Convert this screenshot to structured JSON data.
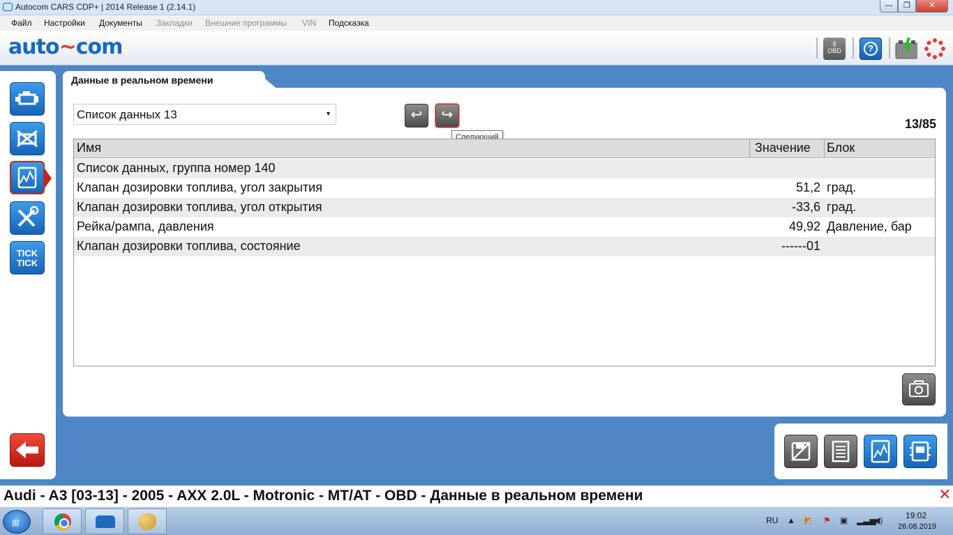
{
  "window": {
    "title": "Autocom CARS CDP+ | 2014 Release 1 (2.14.1)",
    "min_glyph": "—",
    "max_glyph": "❐",
    "close_glyph": "✕"
  },
  "menu": {
    "items": [
      {
        "label": "Файл"
      },
      {
        "label": "Настройки"
      },
      {
        "label": "Документы"
      },
      {
        "label": "Закладки"
      },
      {
        "label": "Внешние программы"
      },
      {
        "label": "VIN"
      },
      {
        "label": "Подсказка"
      }
    ]
  },
  "header": {
    "logo_left": "auto",
    "logo_wave": "~",
    "logo_right": "com",
    "obd_label": "OBD",
    "obd_symbol": "§",
    "help_glyph": "?"
  },
  "tab": {
    "title": "Данные в реальном времени"
  },
  "controls": {
    "list_value": "Список данных 13",
    "list_caret": "▼",
    "prev_glyph": "↩",
    "next_glyph": "↪",
    "tooltip": "Следующий",
    "page_counter": "13/85"
  },
  "grid": {
    "headers": {
      "name": "Имя",
      "value": "Значение",
      "unit": "Блок"
    },
    "rows": [
      {
        "name": "Список данных, группа номер 140",
        "value": "",
        "unit": ""
      },
      {
        "name": "Клапан дозировки топлива, угол закрытия",
        "value": "51,2",
        "unit": "град."
      },
      {
        "name": "Клапан дозировки топлива, угол открытия",
        "value": "-33,6",
        "unit": "град."
      },
      {
        "name": "Рейка/рампа, давления",
        "value": "49,92",
        "unit": "Давление, бар"
      },
      {
        "name": "Клапан дозировки топлива, состояние",
        "value": "------01",
        "unit": ""
      }
    ]
  },
  "sidebar": {
    "tick_label": "TICK\nTICK"
  },
  "status": {
    "text": "Audi - A3 [03-13] - 2005 - AXX 2.0L - Motronic - MT/AT - OBD - Данные в реальном времени"
  },
  "taskbar": {
    "language": "RU",
    "time": "19:02",
    "date": "26.08.2019"
  },
  "icons": {
    "engine": "engine-icon",
    "dtc": "dtc-clear-icon",
    "live_data": "live-data-icon",
    "tools": "tools-icon",
    "tick": "tick-tick-icon",
    "back": "back-arrow-icon",
    "camera": "camera-icon"
  },
  "colors": {
    "accent": "#1664b8",
    "active_border": "#c1271b",
    "background": "#4f86c6"
  }
}
